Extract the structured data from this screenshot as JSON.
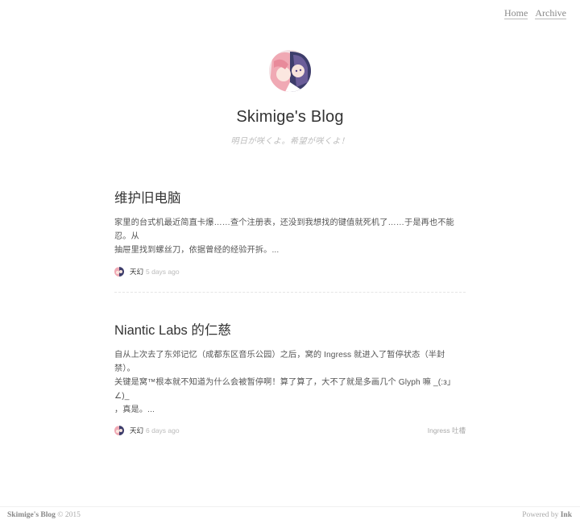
{
  "nav": {
    "items": [
      {
        "label": "Home"
      },
      {
        "label": "Archive"
      }
    ]
  },
  "header": {
    "title": "Skimige's Blog",
    "subtitle": "明日が咲くよ。希望が咲くよ！",
    "avatar_icon": "anime-character-avatar-icon"
  },
  "posts": [
    {
      "title": "维护旧电脑",
      "excerpt_line1": "家里的台式机最近简直卡爆……查个注册表，还没到我想找的键值就死机了……于是再也不能忍。从",
      "excerpt_line2": "抽屉里找到螺丝刀，依据曾经的经验开拆。...",
      "author": "天幻",
      "time": "5 days ago",
      "tags": ""
    },
    {
      "title": "Niantic Labs 的仁慈",
      "excerpt_line1": "自从上次去了东郊记忆（成都东区音乐公园）之后，窝的 Ingress 就进入了暂停状态（半封禁）。",
      "excerpt_line2": "关键是窝™根本就不知道为什么会被暂停啊！算了算了，大不了就是多画几个 Glyph 嘛 _(:з」∠)_",
      "excerpt_line3": "，真是。...",
      "author": "天幻",
      "time": "6 days ago",
      "tags": "Ingress 吐槽"
    }
  ],
  "footer": {
    "left_brand": "Skimige's Blog",
    "left_copy": "© 2015",
    "right_prefix": "Powered by",
    "right_brand": "Ink"
  },
  "colors": {
    "background": "#ffffff",
    "title": "#333333",
    "muted": "#bbbbbb",
    "divider": "#e4e4e4"
  }
}
